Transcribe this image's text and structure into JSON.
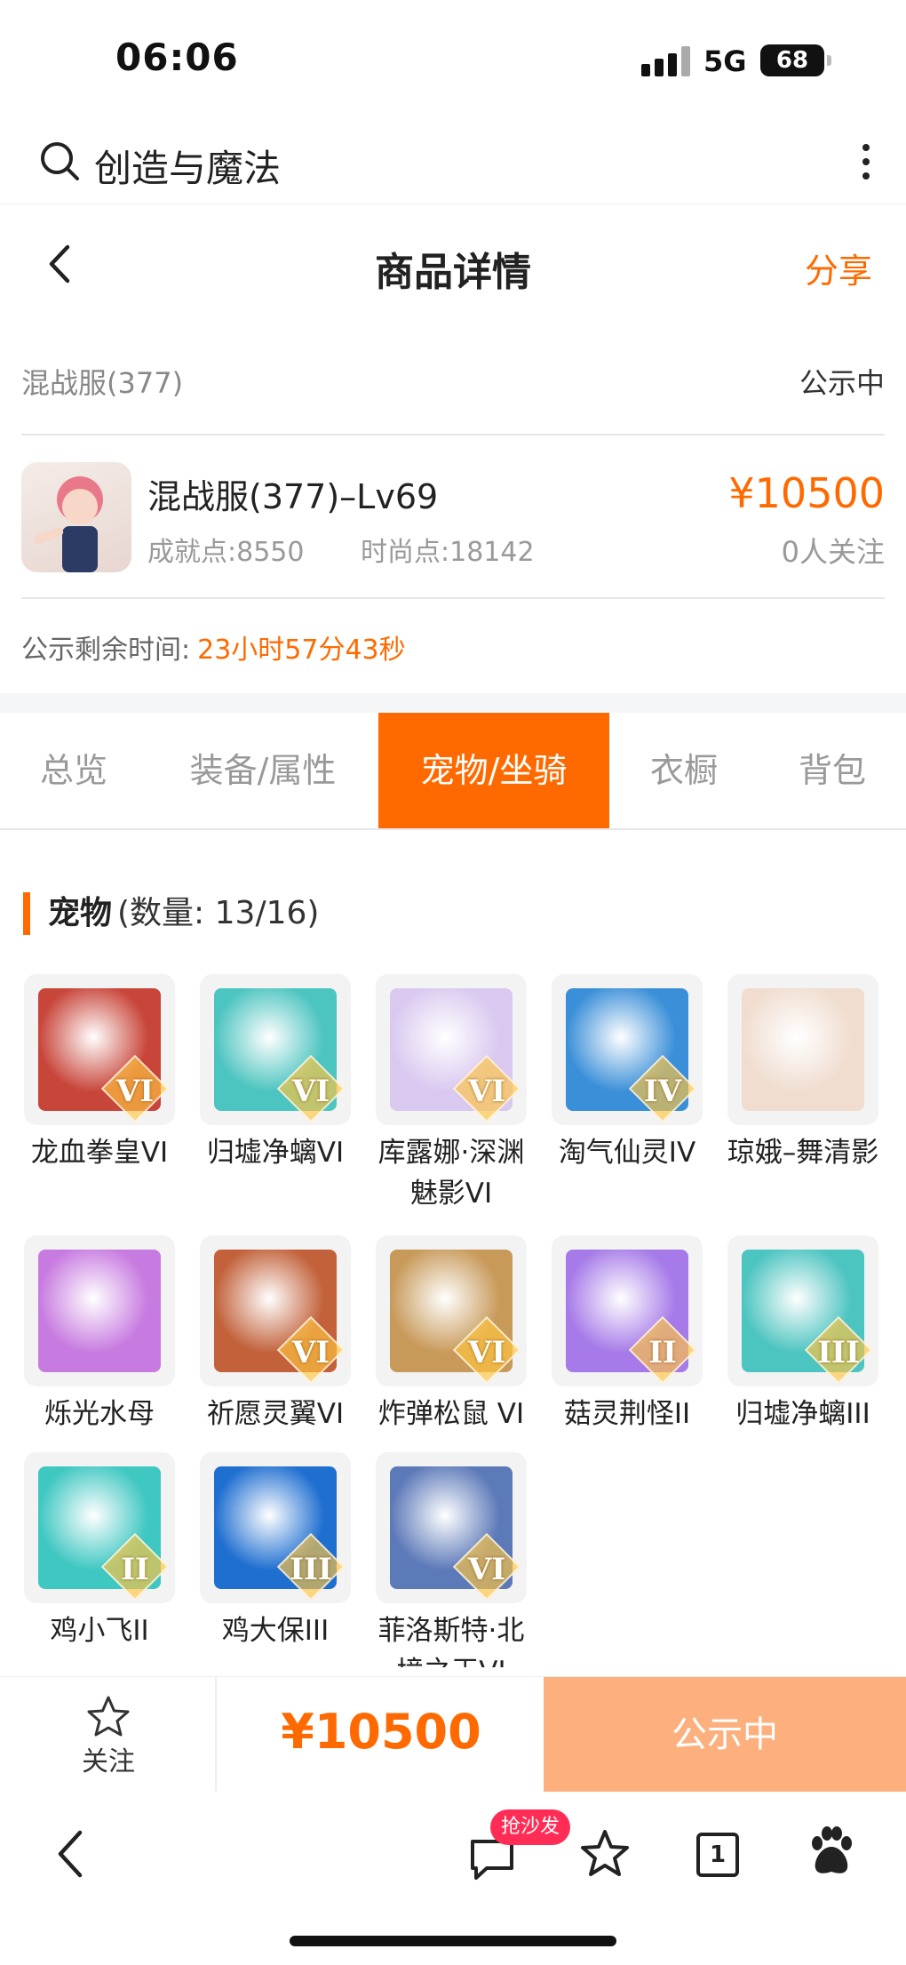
{
  "status_bar": {
    "time": "06:06",
    "network": "5G",
    "battery": "68"
  },
  "search": {
    "query": "创造与魔法"
  },
  "header": {
    "title": "商品详情",
    "share": "分享"
  },
  "server": {
    "name": "混战服(377)",
    "status": "公示中"
  },
  "product": {
    "name": "混战服(377)–Lv69",
    "achievement": "成就点:8550",
    "fashion": "时尚点:18142",
    "price": "¥10500",
    "watchers": "0人关注"
  },
  "timer": {
    "label": "公示剩余时间:",
    "value": "23小时57分43秒"
  },
  "tabs": [
    {
      "label": "总览"
    },
    {
      "label": "装备/属性"
    },
    {
      "label": "宠物/坐骑"
    },
    {
      "label": "衣橱"
    },
    {
      "label": "背包"
    }
  ],
  "section": {
    "title": "宠物",
    "count": "(数量: 13/16)"
  },
  "pets": [
    {
      "name": "龙血拳皇VI",
      "tier": "VI",
      "color": "#c8453a"
    },
    {
      "name": "归墟净螭VI",
      "tier": "VI",
      "color": "#4cc4c0"
    },
    {
      "name": "库露娜·深渊魅影VI",
      "tier": "VI",
      "color": "#d9c8f0"
    },
    {
      "name": "淘气仙灵IV",
      "tier": "IV",
      "color": "#3a8fd8"
    },
    {
      "name": "琼娥–舞清影",
      "tier": "",
      "color": "#f0ddd0"
    },
    {
      "name": "烁光水母",
      "tier": "",
      "color": "#c77ae0"
    },
    {
      "name": "祈愿灵翼VI",
      "tier": "VI",
      "color": "#c2613a"
    },
    {
      "name": "炸弹松鼠 VI",
      "tier": "VI",
      "color": "#c89a5a"
    },
    {
      "name": "菇灵荆怪II",
      "tier": "II",
      "color": "#a67ae8"
    },
    {
      "name": "归墟净螭III",
      "tier": "III",
      "color": "#4cc4c0"
    },
    {
      "name": "鸡小飞II",
      "tier": "II",
      "color": "#3fc7c2"
    },
    {
      "name": "鸡大保III",
      "tier": "III",
      "color": "#1f6fd0"
    },
    {
      "name": "菲洛斯特·北境之王VI",
      "tier": "VI",
      "color": "#5c79b8"
    }
  ],
  "action_bar": {
    "follow": "关注",
    "price": "¥10500",
    "status": "公示中"
  },
  "browser_nav": {
    "hot_badge": "抢沙发",
    "tab_count": "1"
  },
  "colors": {
    "accent": "#ff6a00",
    "status_button": "#fdb07e",
    "badge": "#ff2d55"
  }
}
